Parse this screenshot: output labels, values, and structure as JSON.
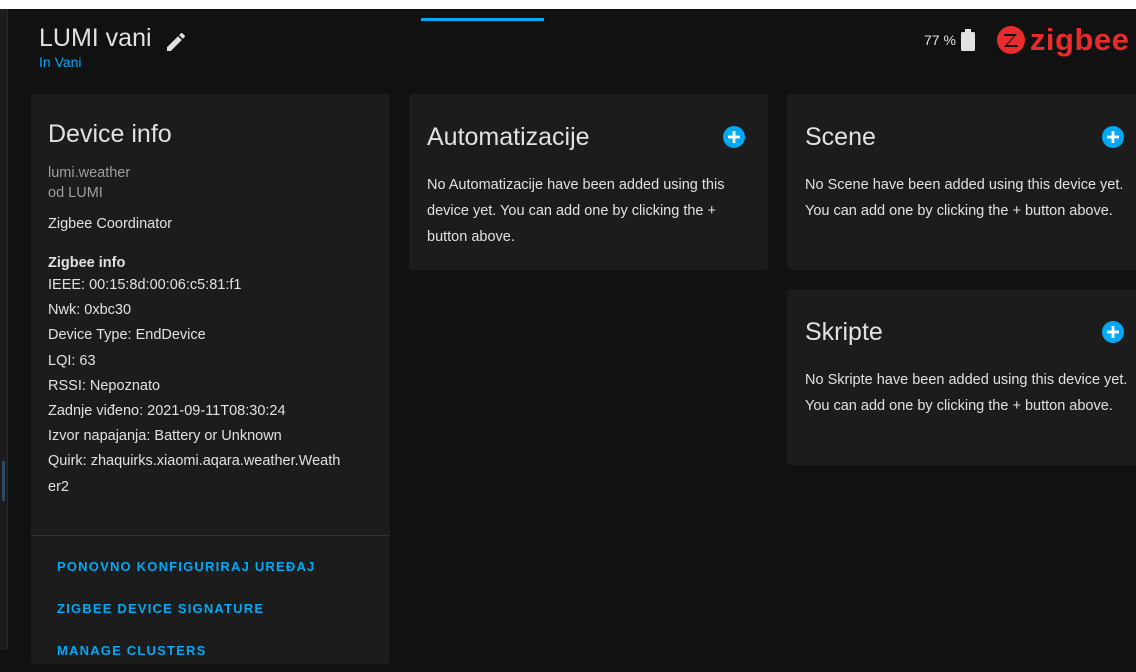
{
  "device": {
    "name": "LUMI vani",
    "area": "In Vani",
    "battery": "77 %"
  },
  "brand": {
    "logo_text": "zigbee",
    "color": "#ea2b2b"
  },
  "accent": "#03a9f4",
  "device_info": {
    "title": "Device info",
    "model": "lumi.weather",
    "manufacturer": "od LUMI",
    "via": "Zigbee Coordinator",
    "zigbee_title": "Zigbee info",
    "zigbee_lines": [
      "IEEE: 00:15:8d:00:06:c5:81:f1",
      "Nwk: 0xbc30",
      "Device Type: EndDevice",
      "LQI: 63",
      "RSSI: Nepoznato",
      "Zadnje viđeno: 2021-09-11T08:30:24",
      "Izvor napajanja: Battery or Unknown",
      "Quirk: zhaquirks.xiaomi.aqara.weather.Weath",
      "er2"
    ],
    "actions": [
      "PONOVNO KONFIGURIRAJ UREĐAJ",
      "ZIGBEE DEVICE SIGNATURE",
      "MANAGE CLUSTERS"
    ]
  },
  "automations": {
    "title": "Automatizacije",
    "empty_text": "No Automatizacije have been added using this device yet. You can add one by clicking the + button above.",
    "add_icon": "plus-circle-icon"
  },
  "scenes": {
    "title": "Scene",
    "empty_text": "No Scene have been added using this device yet. You can add one by clicking the + button above.",
    "add_icon": "plus-circle-icon"
  },
  "scripts": {
    "title": "Skripte",
    "empty_text": "No Skripte have been added using this device yet. You can add one by clicking the + button above.",
    "add_icon": "plus-circle-icon"
  }
}
